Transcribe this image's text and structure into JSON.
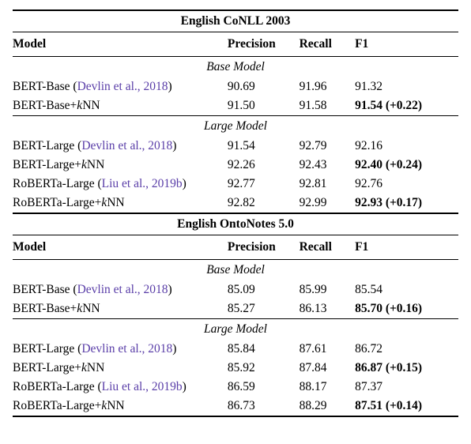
{
  "datasets": [
    {
      "title": "English CoNLL 2003",
      "columns": {
        "model": "Model",
        "precision": "Precision",
        "recall": "Recall",
        "f1": "F1"
      },
      "sections": [
        {
          "label": "Base Model",
          "rows": [
            {
              "model_plain": "BERT-Base (",
              "model_cite": "Devlin et al., 2018",
              "model_after": ")",
              "precision": "90.69",
              "recall": "91.96",
              "f1": "91.32",
              "f1_bold": false
            },
            {
              "model_plain": "BERT-Base+",
              "model_italic": "k",
              "model_after": "NN",
              "precision": "91.50",
              "recall": "91.58",
              "f1": "91.54 (+0.22)",
              "f1_bold": true
            }
          ]
        },
        {
          "label": "Large Model",
          "rows": [
            {
              "model_plain": "BERT-Large (",
              "model_cite": "Devlin et al., 2018",
              "model_after": ")",
              "precision": "91.54",
              "recall": "92.79",
              "f1": "92.16",
              "f1_bold": false
            },
            {
              "model_plain": "BERT-Large+",
              "model_italic": "k",
              "model_after": "NN",
              "precision": "92.26",
              "recall": "92.43",
              "f1": "92.40 (+0.24)",
              "f1_bold": true
            },
            {
              "model_plain": "RoBERTa-Large (",
              "model_cite": "Liu et al., 2019b",
              "model_after": ")",
              "precision": "92.77",
              "recall": "92.81",
              "f1": "92.76",
              "f1_bold": false
            },
            {
              "model_plain": "RoBERTa-Large+",
              "model_italic": "k",
              "model_after": "NN",
              "precision": "92.82",
              "recall": "92.99",
              "f1": "92.93 (+0.17)",
              "f1_bold": true
            }
          ]
        }
      ]
    },
    {
      "title": "English OntoNotes 5.0",
      "columns": {
        "model": "Model",
        "precision": "Precision",
        "recall": "Recall",
        "f1": "F1"
      },
      "sections": [
        {
          "label": "Base Model",
          "rows": [
            {
              "model_plain": "BERT-Base (",
              "model_cite": "Devlin et al., 2018",
              "model_after": ")",
              "precision": "85.09",
              "recall": "85.99",
              "f1": "85.54",
              "f1_bold": false
            },
            {
              "model_plain": "BERT-Base+",
              "model_italic": "k",
              "model_after": "NN",
              "precision": "85.27",
              "recall": "86.13",
              "f1": "85.70 (+0.16)",
              "f1_bold": true
            }
          ]
        },
        {
          "label": "Large Model",
          "rows": [
            {
              "model_plain": "BERT-Large (",
              "model_cite": "Devlin et al., 2018",
              "model_after": ")",
              "precision": "85.84",
              "recall": "87.61",
              "f1": "86.72",
              "f1_bold": false
            },
            {
              "model_plain": "BERT-Large+",
              "model_italic": "k",
              "model_after": "NN",
              "precision": "85.92",
              "recall": "87.84",
              "f1": "86.87 (+0.15)",
              "f1_bold": true
            },
            {
              "model_plain": "RoBERTa-Large (",
              "model_cite": "Liu et al., 2019b",
              "model_after": ")",
              "precision": "86.59",
              "recall": "88.17",
              "f1": "87.37",
              "f1_bold": false
            },
            {
              "model_plain": "RoBERTa-Large+",
              "model_italic": "k",
              "model_after": "NN",
              "precision": "86.73",
              "recall": "88.29",
              "f1": "87.51 (+0.14)",
              "f1_bold": true
            }
          ]
        }
      ]
    }
  ],
  "chart_data": {
    "type": "table",
    "title": "NER results on English CoNLL 2003 and OntoNotes 5.0",
    "tables": [
      {
        "dataset": "English CoNLL 2003",
        "columns": [
          "Model",
          "Precision",
          "Recall",
          "F1"
        ],
        "rows": [
          [
            "BERT-Base (Devlin et al., 2018)",
            90.69,
            91.96,
            91.32
          ],
          [
            "BERT-Base+kNN",
            91.5,
            91.58,
            91.54
          ],
          [
            "BERT-Large (Devlin et al., 2018)",
            91.54,
            92.79,
            92.16
          ],
          [
            "BERT-Large+kNN",
            92.26,
            92.43,
            92.4
          ],
          [
            "RoBERTa-Large (Liu et al., 2019b)",
            92.77,
            92.81,
            92.76
          ],
          [
            "RoBERTa-Large+kNN",
            92.82,
            92.99,
            92.93
          ]
        ]
      },
      {
        "dataset": "English OntoNotes 5.0",
        "columns": [
          "Model",
          "Precision",
          "Recall",
          "F1"
        ],
        "rows": [
          [
            "BERT-Base (Devlin et al., 2018)",
            85.09,
            85.99,
            85.54
          ],
          [
            "BERT-Base+kNN",
            85.27,
            86.13,
            85.7
          ],
          [
            "BERT-Large (Devlin et al., 2018)",
            85.84,
            87.61,
            86.72
          ],
          [
            "BERT-Large+kNN",
            85.92,
            87.84,
            86.87
          ],
          [
            "RoBERTa-Large (Liu et al., 2019b)",
            86.59,
            88.17,
            87.37
          ],
          [
            "RoBERTa-Large+kNN",
            86.73,
            88.29,
            87.51
          ]
        ]
      }
    ]
  }
}
